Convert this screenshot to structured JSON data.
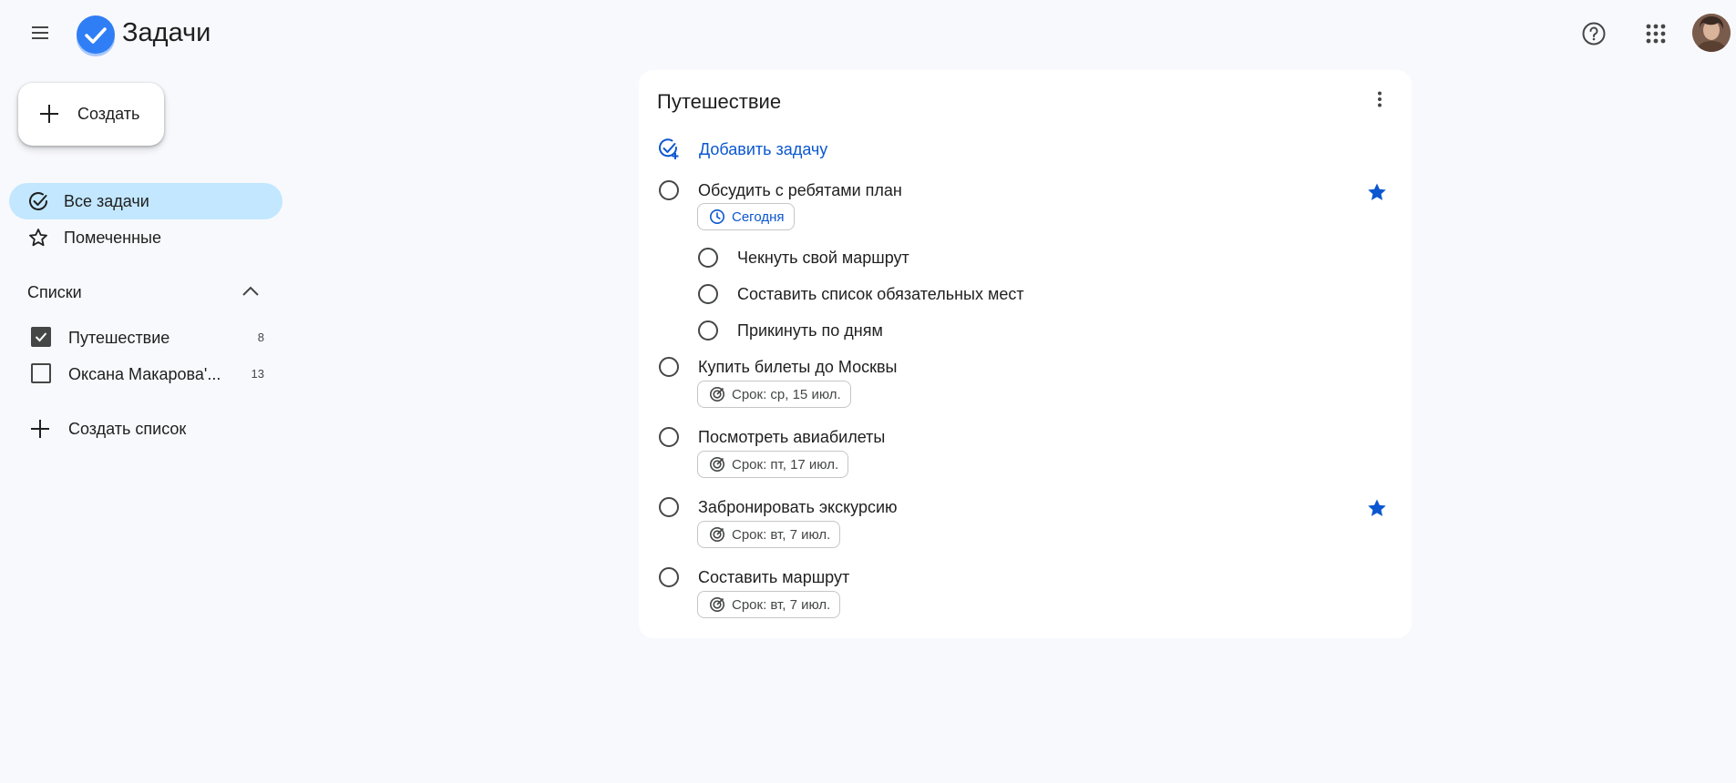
{
  "app": {
    "title": "Задачи"
  },
  "sidebar": {
    "create_label": "Создать",
    "nav": [
      {
        "label": "Все задачи",
        "active": true
      },
      {
        "label": "Помеченные",
        "active": false
      }
    ],
    "lists_title": "Списки",
    "lists": [
      {
        "label": "Путешествие",
        "count": "8",
        "checked": true
      },
      {
        "label": "Оксана Макарова'...",
        "count": "13",
        "checked": false
      }
    ],
    "create_list_label": "Создать список"
  },
  "main": {
    "list_title": "Путешествие",
    "add_task_label": "Добавить задачу",
    "tasks": [
      {
        "title": "Обсудить с ребятами план",
        "chip": "Сегодня",
        "starred": true
      },
      {
        "title": "Чекнуть свой маршрут",
        "subtask": true
      },
      {
        "title": "Составить список обязательных мест",
        "subtask": true
      },
      {
        "title": "Прикинуть по дням",
        "subtask": true
      },
      {
        "title": "Купить билеты до Москвы",
        "chip": "Срок: ср, 15 июл.",
        "starred": false
      },
      {
        "title": "Посмотреть авиабилеты",
        "chip": "Срок: пт, 17 июл.",
        "starred": false
      },
      {
        "title": "Забронировать экскурсию",
        "chip": "Срок: вт, 7 июл.",
        "starred": true
      },
      {
        "title": "Составить маршрут",
        "chip": "Срок: вт, 7 июл.",
        "starred": false
      }
    ]
  },
  "colors": {
    "accent": "#0b57d0",
    "active_nav": "#c2e7ff",
    "background": "#f8f9fd"
  }
}
